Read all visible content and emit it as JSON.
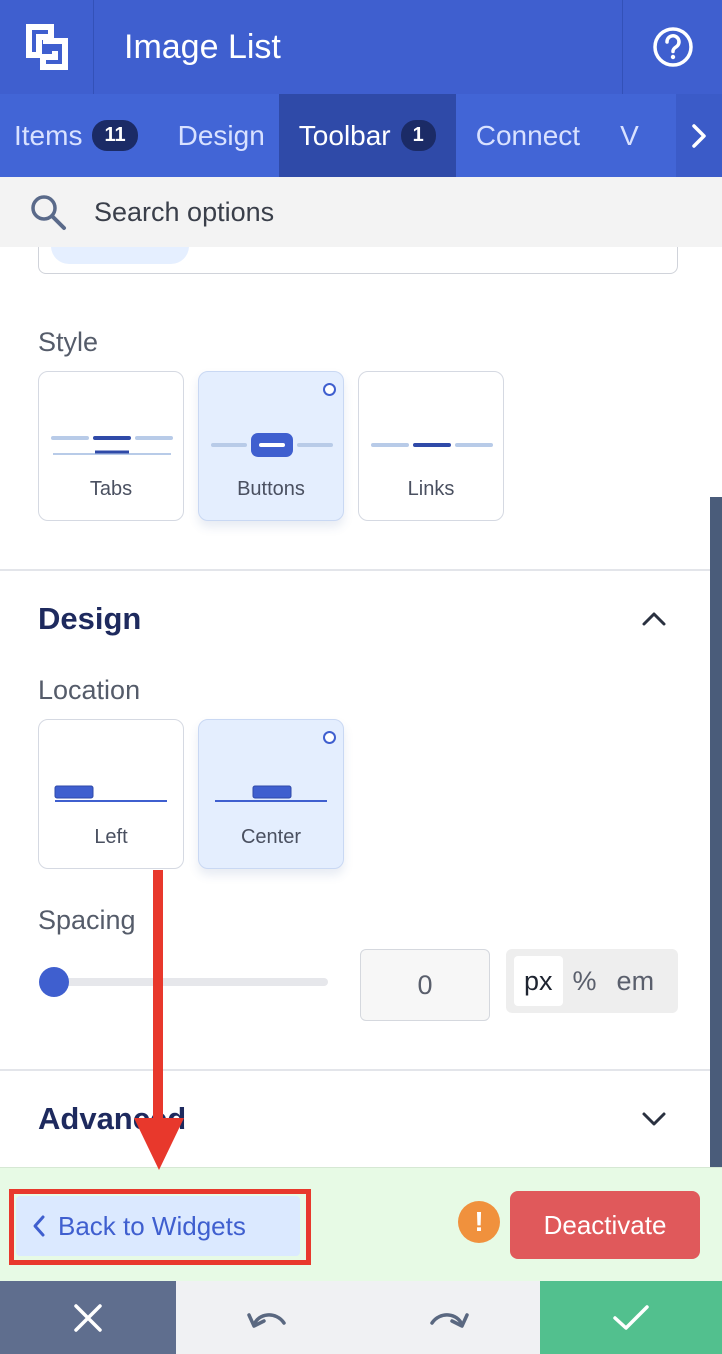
{
  "header": {
    "title": "Image List"
  },
  "tabs": [
    {
      "label": "Items",
      "badge": "11"
    },
    {
      "label": "Design"
    },
    {
      "label": "Toolbar",
      "badge": "1"
    },
    {
      "label": "Connect"
    },
    {
      "label": "V"
    }
  ],
  "search": {
    "placeholder": "Search options"
  },
  "style_section": {
    "label": "Style",
    "options": [
      {
        "label": "Tabs",
        "selected": false
      },
      {
        "label": "Buttons",
        "selected": true
      },
      {
        "label": "Links",
        "selected": false
      }
    ]
  },
  "design_section": {
    "title": "Design",
    "location_label": "Location",
    "location_options": [
      {
        "label": "Left",
        "selected": false
      },
      {
        "label": "Center",
        "selected": true
      }
    ],
    "spacing_label": "Spacing",
    "spacing_value": "0",
    "units": [
      "px",
      "%",
      "em"
    ],
    "active_unit": "px"
  },
  "advanced_section": {
    "title": "Advanced"
  },
  "actions": {
    "back_label": "Back to Widgets",
    "warning_symbol": "!",
    "deactivate_label": "Deactivate"
  },
  "colors": {
    "primary": "#3f5fcf",
    "header": "#3f5fcf",
    "action_bar": "#e7fae5",
    "deactivate": "#e0595b",
    "confirm": "#52c08e",
    "annotation": "#e8382c"
  }
}
